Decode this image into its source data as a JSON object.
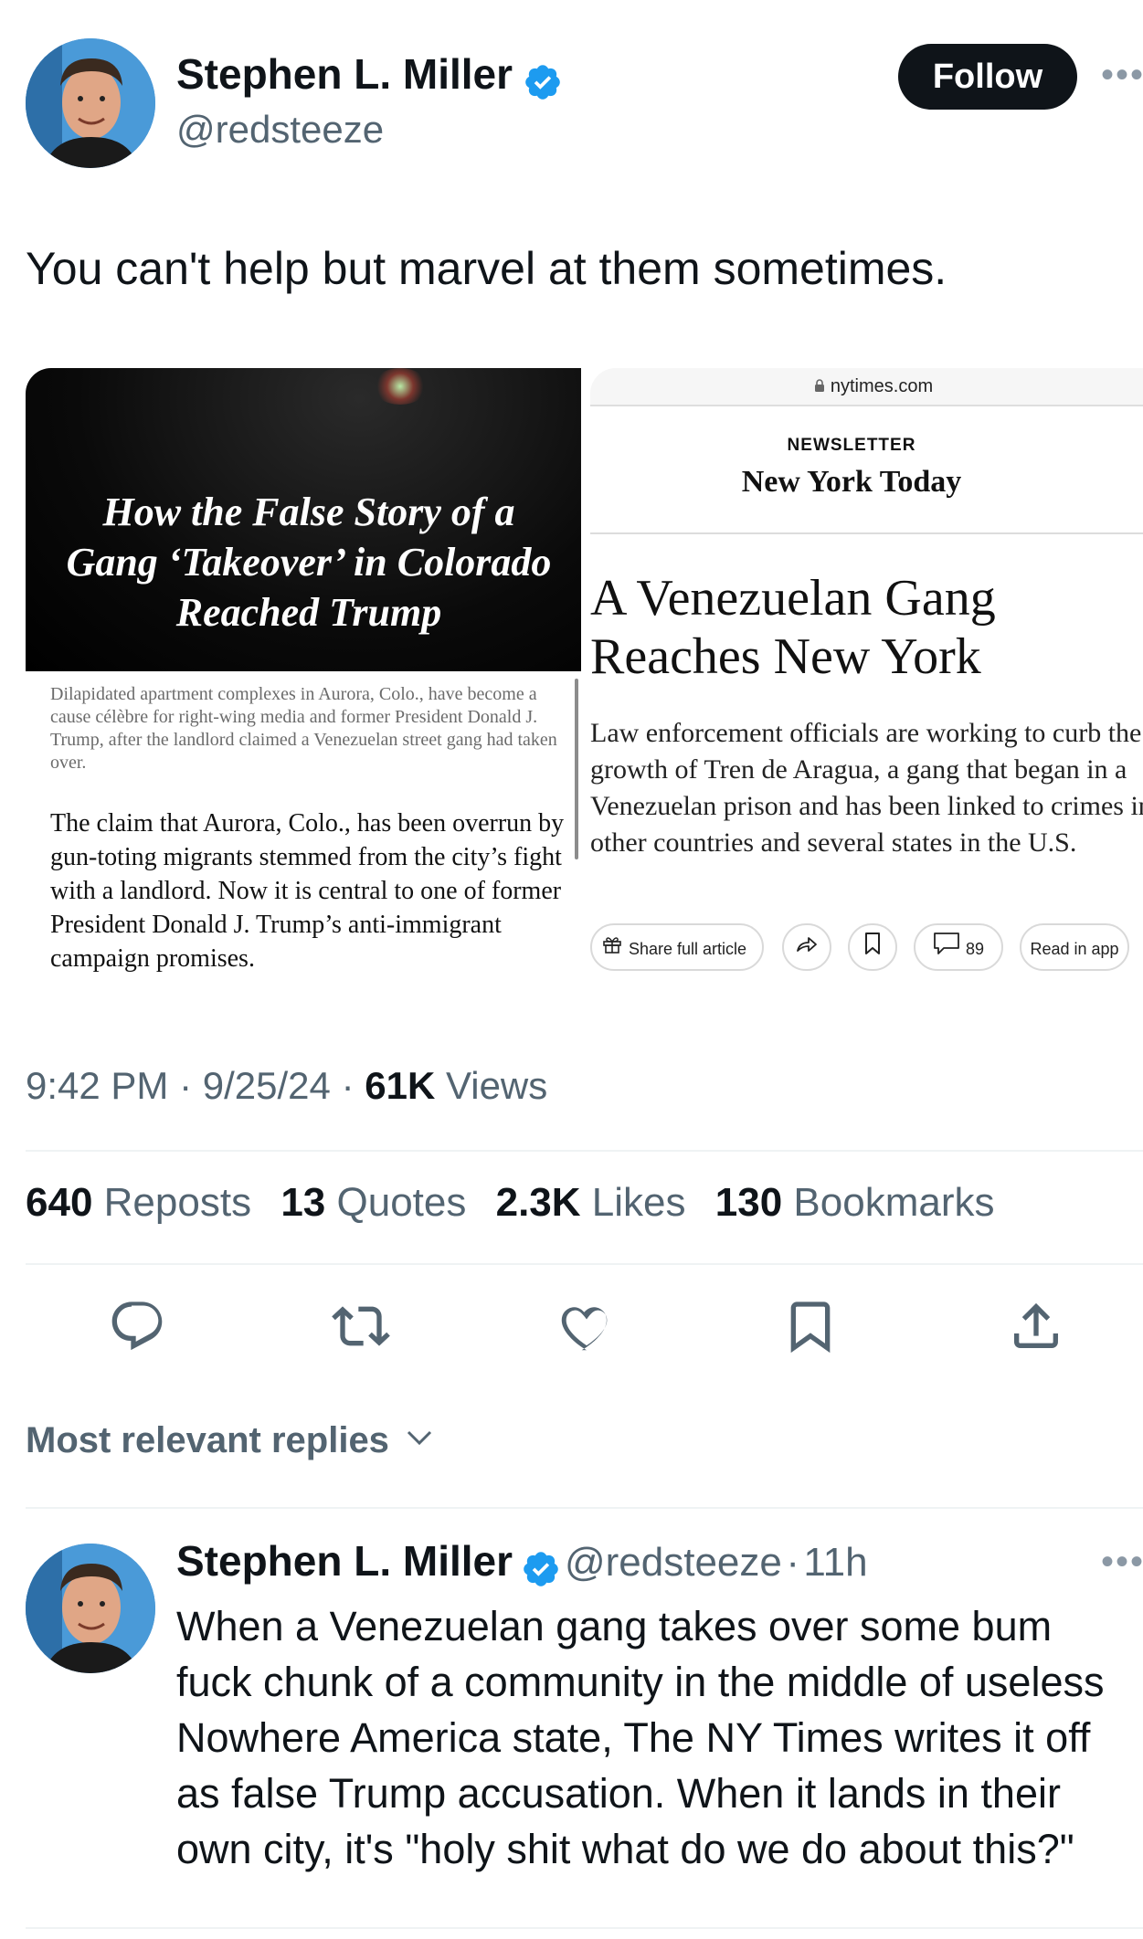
{
  "tweet": {
    "author_name": "Stephen L. Miller",
    "author_handle": "@redsteeze",
    "follow_label": "Follow",
    "more_label": "•••",
    "text": "You can't help but marvel at them sometimes.",
    "time": "9:42 PM",
    "date": "9/25/24",
    "views_count": "61K",
    "views_label": "Views",
    "sep": "·"
  },
  "media": {
    "left": {
      "photo_title": "How the False Story of a Gang ‘Takeover’ in Colorado Reached Trump",
      "caption": "Dilapidated apartment complexes in Aurora, Colo., have become a cause célèbre for right-wing media and former President Donald J. Trump, after the landlord claimed a Venezuelan street gang had taken over.",
      "lead": "The claim that Aurora, Colo., has been overrun by gun-toting migrants stemmed from the city’s fight with a landlord. Now it is central to one of former President Donald J. Trump’s anti-immigrant campaign promises."
    },
    "right": {
      "url": "nytimes.com",
      "newsletter_label": "NEWSLETTER",
      "newsletter_title": "New York Today",
      "headline": "A Venezuelan Gang Reaches New York",
      "summary": "Law enforcement officials are working to curb the growth of Tren de Aragua, a gang that began in a Venezuelan prison and has been linked to crimes in other countries and several states in the U.S.",
      "share_label": "Share full article",
      "comments_count": "89",
      "read_in_app_label": "Read in app"
    }
  },
  "stats": [
    {
      "count": "640",
      "label": "Reposts"
    },
    {
      "count": "13",
      "label": "Quotes"
    },
    {
      "count": "2.3K",
      "label": "Likes"
    },
    {
      "count": "130",
      "label": "Bookmarks"
    }
  ],
  "replies": {
    "sort_label": "Most relevant replies",
    "items": [
      {
        "author_name": "Stephen L. Miller",
        "author_handle": "@redsteeze",
        "sep": "·",
        "time": "11h",
        "text": "When a Venezuelan gang takes over some bum fuck chunk of a community in the middle of useless Nowhere America state, The NY Times writes it off as false Trump accusation. When it lands in their own city, it's \"holy shit what do we do about this?\""
      }
    ]
  },
  "colors": {
    "verified": "#1d9bf0",
    "secondary_text": "#536471",
    "primary_text": "#0f1419",
    "action_icon": "#536471"
  },
  "icons": [
    "verified-badge-icon",
    "reply-icon",
    "repost-icon",
    "like-icon",
    "bookmark-icon",
    "share-icon",
    "chevron-down-icon",
    "lock-icon",
    "gift-icon",
    "forward-icon",
    "comment-icon"
  ]
}
